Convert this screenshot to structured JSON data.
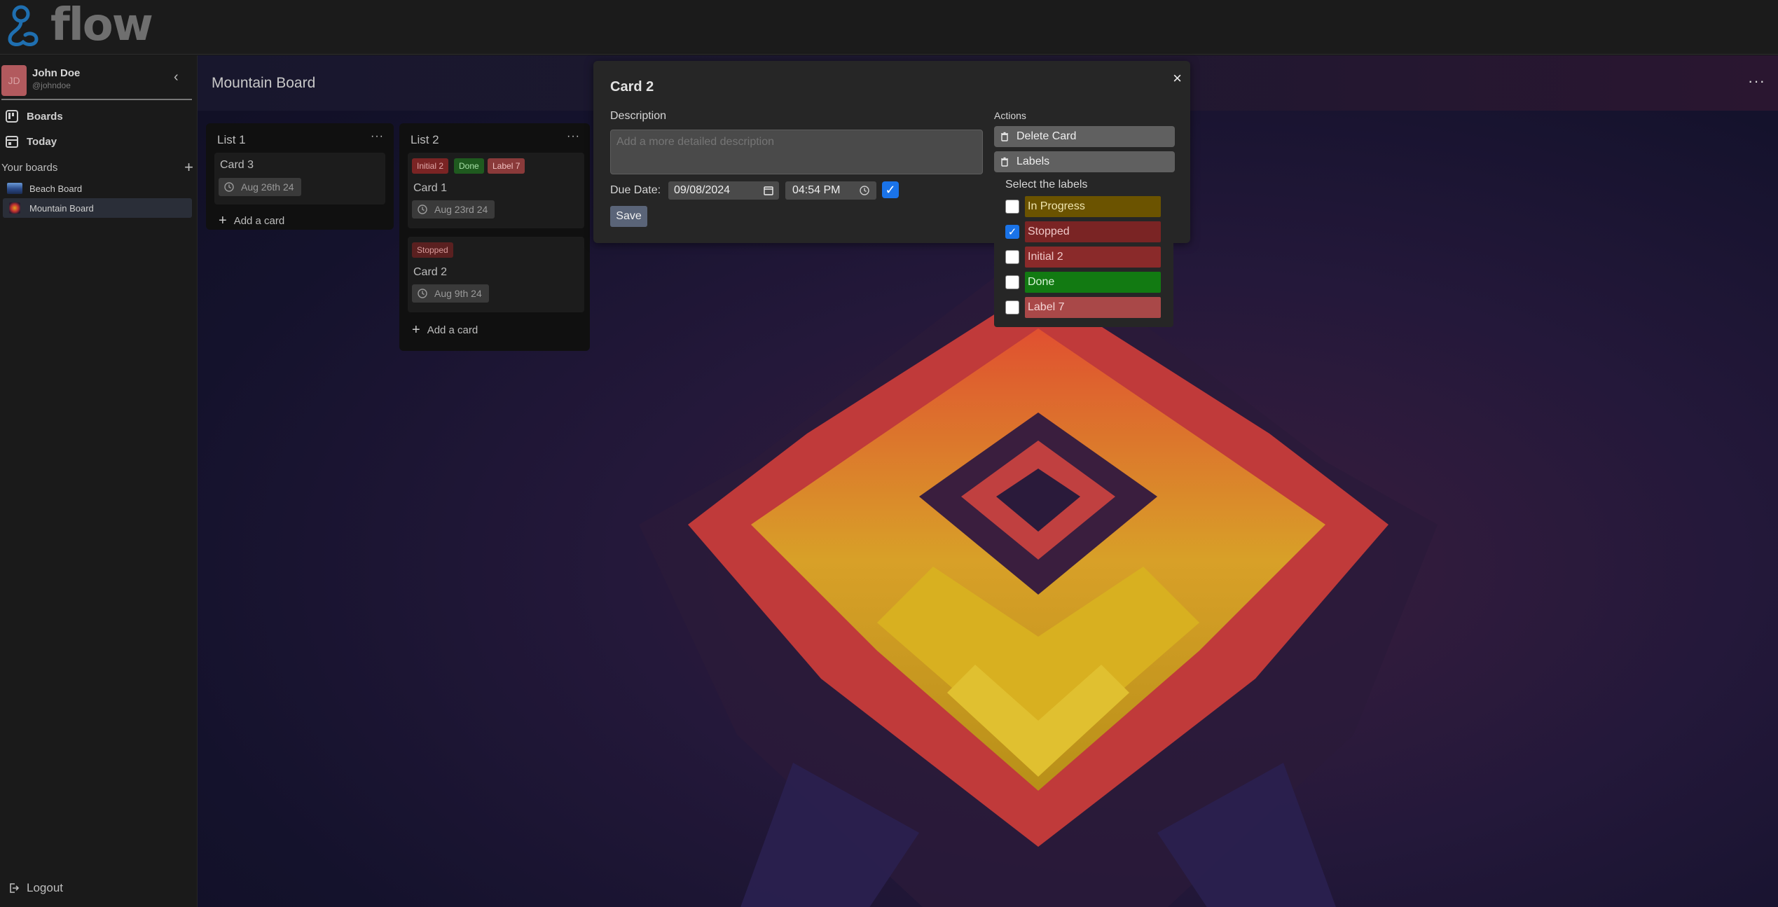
{
  "app": {
    "logo_text": "flow"
  },
  "user": {
    "initials": "JD",
    "name": "John Doe",
    "handle": "@johndoe"
  },
  "sidebar": {
    "nav": [
      {
        "label": "Boards"
      },
      {
        "label": "Today"
      }
    ],
    "your_boards_label": "Your boards",
    "boards": [
      {
        "label": "Beach Board"
      },
      {
        "label": "Mountain Board"
      }
    ],
    "logout_label": "Logout"
  },
  "board": {
    "title": "Mountain Board",
    "more_label": "···"
  },
  "lists": [
    {
      "title": "List 1",
      "more_label": "···",
      "cards": [
        {
          "title": "Card 3",
          "date": "Aug 26th 24",
          "labels": []
        }
      ],
      "add_card_label": "Add a card"
    },
    {
      "title": "List 2",
      "more_label": "···",
      "cards": [
        {
          "title": "Card 1",
          "date": "Aug 23rd 24",
          "labels": [
            "Initial 2",
            "Done",
            "Label 7"
          ]
        },
        {
          "title": "Card 2",
          "date": "Aug 9th 24",
          "labels": [
            "Stopped"
          ]
        }
      ],
      "add_card_label": "Add a card"
    }
  ],
  "modal": {
    "title": "Card 2",
    "close_label": "×",
    "description_label": "Description",
    "description_placeholder": "Add a more detailed description",
    "description_value": "",
    "due_date_label": "Due Date:",
    "due_date_value": "09/08/2024",
    "due_time_value": "04:54 PM",
    "due_checked": true,
    "save_label": "Save",
    "actions_label": "Actions",
    "delete_label": "Delete Card",
    "labels_label": "Labels",
    "select_labels_title": "Select the labels",
    "label_options": [
      {
        "name": "In Progress",
        "checked": false,
        "color": "#6b5300",
        "text_color": "#f0e6b0"
      },
      {
        "name": "Stopped",
        "checked": true,
        "color": "#7a2424",
        "text_color": "#f0c8c8"
      },
      {
        "name": "Initial 2",
        "checked": false,
        "color": "#8a2a2a",
        "text_color": "#f0c8c8"
      },
      {
        "name": "Done",
        "checked": false,
        "color": "#127a12",
        "text_color": "#d8f5d8"
      },
      {
        "name": "Label 7",
        "checked": false,
        "color": "#a94848",
        "text_color": "#f5d5d5"
      }
    ]
  },
  "colors": {
    "label_initial2": "#7a2424",
    "label_done": "#1f5a1f",
    "label_label7": "#8a3a3a",
    "label_stopped": "#5a2020",
    "accent_blue": "#1a73e8"
  }
}
